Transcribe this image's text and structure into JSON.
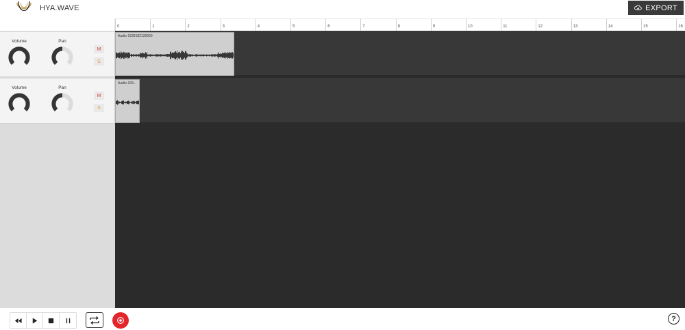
{
  "header": {
    "app_title": "HYA.WAVE",
    "export_label": "EXPORT"
  },
  "ruler": {
    "marks": [
      "0",
      "1",
      "2",
      "3",
      "4",
      "5",
      "6",
      "7",
      "8",
      "9",
      "10",
      "11",
      "12",
      "13",
      "14",
      "15",
      "16"
    ]
  },
  "tracks": [
    {
      "volume_label": "Volume",
      "pan_label": "Pan",
      "mute_label": "M",
      "solo_label": "S",
      "clip_label": "Audio-1639182130669"
    },
    {
      "volume_label": "Volume",
      "pan_label": "Pan",
      "mute_label": "M",
      "solo_label": "S",
      "clip_label": "Audio-163..."
    }
  ],
  "help_label": "?",
  "colors": {
    "accent_record": "#e3262b",
    "mute": "#d9463b",
    "solo": "#e39b2f",
    "logo": "#c8a35a"
  },
  "icons": {
    "rewind": "rewind-icon",
    "play": "play-icon",
    "stop": "stop-icon",
    "pause": "pause-icon",
    "loop": "loop-icon",
    "record": "record-icon",
    "help": "help-icon",
    "export": "cloud-download-icon"
  }
}
